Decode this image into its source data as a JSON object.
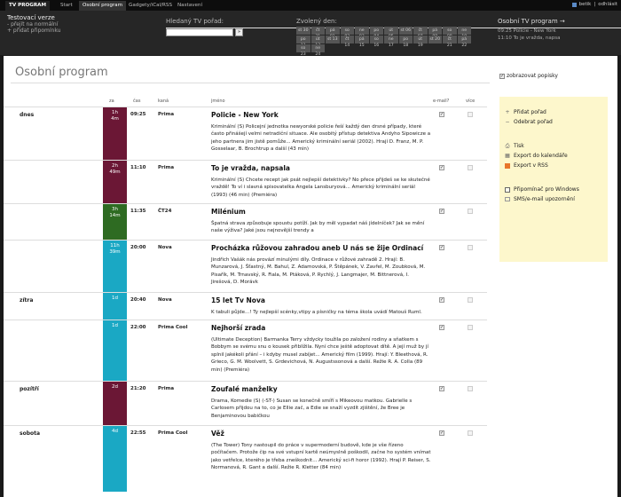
{
  "nav": {
    "tabs": [
      "TV PROGRAM",
      "Start",
      "Osobní program",
      "Gadgety/iCal/RSS",
      "Nastavení"
    ],
    "user": "betik",
    "logout": "odhlásit"
  },
  "header": {
    "title": "Testovací verze",
    "link1": "- přejít na normální",
    "link2": "+ přidat připomínku",
    "search_label": "Hledaný TV pořad:",
    "search_placeholder": "",
    "search_button": "»",
    "day_label": "Zvolený den:",
    "days": [
      "st 30",
      "čt 31",
      "pá 01",
      "so 02",
      "ne 03",
      "po 04",
      "út 05",
      "st 06",
      "čt 07",
      "pá 08",
      "so 09",
      "ne 10",
      "po 11",
      "út 12",
      "st 13",
      "čt 14",
      "pá 15",
      "so 16",
      "ne 17",
      "po 18",
      "út 19",
      "st 20",
      "čt 21",
      "pá 22",
      "so 23",
      "ne 24"
    ],
    "personal_label": "Osobní TV program →",
    "personal_items": [
      "09:25  Policie - New York",
      "11:10  To je vražda, napsa"
    ]
  },
  "page": {
    "title": "Osobní program",
    "columns": {
      "za": "za",
      "cas": "čas",
      "kana": "kaná",
      "jmeno": "jméno",
      "email": "e-mail?",
      "vice": "více"
    },
    "show_desc": "zobrazovat popisky"
  },
  "days_groups": [
    "dnes",
    "zítra",
    "pozítří",
    "sobota"
  ],
  "programs": [
    {
      "day": "dnes",
      "dur1": "1h",
      "dur2": "4m",
      "color": "#6b1735",
      "time": "09:25",
      "channel": "Prima",
      "title": "Policie - New York",
      "desc": "Kriminální (S) Policejní jednotka newyorské policie řeší každý den drsné případy, které často přinášejí velmi netradiční situace. Ale osobitý přístup detektiva Andyho Sipowicze a jeho partnera jim jistě pomůže... Americký kriminální seriál (2002). Hrají D. Franz, M. P. Gosselaar, B. Brochtrup a další (43 min)"
    },
    {
      "day": "",
      "dur1": "2h",
      "dur2": "49m",
      "color": "#6b1735",
      "time": "11:10",
      "channel": "Prima",
      "title": "To je vražda, napsala",
      "desc": "Kriminální (S) Chcete recept jak psát nejlepší detektivky? No přece přijdeš se ke skutečné vraždě! To ví i slavná spisovatelka Angela Lansburyová... Americký kriminální seriál (1993) (46 min) (Premiéra)"
    },
    {
      "day": "",
      "dur1": "3h",
      "dur2": "14m",
      "color": "#2e6b22",
      "time": "11:35",
      "channel": "ČT24",
      "title": "Milénium",
      "desc": "Špatná strava způsobuje spoustu potíží. Jak by měl vypadat náš jídelníček? Jak se mění naše výživa? Jaké jsou nejnovější trendy a"
    },
    {
      "day": "",
      "dur1": "11h",
      "dur2": "39m",
      "color": "#1aa8c4",
      "time": "20:00",
      "channel": "Nova",
      "title": "Procházka růžovou zahradou aneb U nás se žije Ordinací",
      "desc": "Jindřich Vašák nás provází minulými díly. Ordinace v růžové zahradě 2. Hrají: B. Munzarová, J. Šťastný, M. Bahul, Z. Adamovská, P. Štěpánek, V. Zavřel, M. Zoubková, M. Pisařík, M. Trnavský, R. Fiala, M. Ptáková, P. Rychlý, J. Langmajer, M. Bittnerová, I. Jirešová, D. Morávk"
    },
    {
      "day": "zítra",
      "dur1": "1d",
      "dur2": "",
      "color": "#1aa8c4",
      "time": "20:40",
      "channel": "Nova",
      "title": "15 let Tv Nova",
      "desc": "K tabuli půjde...! Ty nejlepší scénky,vtipy a písničky na téma škola uvádí Matouš Ruml."
    },
    {
      "day": "",
      "dur1": "1d",
      "dur2": "",
      "color": "#1aa8c4",
      "time": "22:00",
      "channel": "Prima Cool",
      "title": "Nejhorší zrada",
      "desc": "(Ultimate Deception) Barmanka Terry vždycky toužila po založení rodiny a sňatkem s Bobbym se svému snu o kousek přiblížila. Nyní chce ještě adoptovat dítě. A její muž by jí splnil jakékoli přání – i kdyby musel zabíjet... Americký film (1999). Hrají: Y. Bleethová, R. Grieco, G. M. Woolvett, S. Grdevichová, N. Augustssonová a další. Režie R. A. Colla (89 min) (Premiéra)"
    },
    {
      "day": "pozítří",
      "dur1": "2d",
      "dur2": "",
      "color": "#6b1735",
      "time": "21:20",
      "channel": "Prima",
      "title": "Zoufalé manželky",
      "desc": "Drama, Komedie (S) (-ST-) Susan se konečně smíří s Mikeovou matkou. Gabrielle s Carlosem přijdou na to, co je Ellie zač, a Edie se snaží vyzdít zjištění, že Bree je Benjaminovou babičkou"
    },
    {
      "day": "sobota",
      "dur1": "4d",
      "dur2": "",
      "color": "#1aa8c4",
      "time": "22:55",
      "channel": "Prima Cool",
      "title": "Věž",
      "desc": "(The Tower) Tony nastoupil do práce v supermoderní budově, kde je vše řízeno počítačem. Protože čip na své vstupní kartě neúmyslně poškodil, začne ho systém vnímat jako vetřelce, kterého je třeba zneškodnit... Americký sci-fi horor (1992). Hrají P. Reiser, S. Normanová, R. Gant a další. Režie R. Kletter (84 min)"
    }
  ],
  "sidebar": {
    "add": "Přidat pořad",
    "remove": "Odebrat pořad",
    "print": "Tisk",
    "export_cal": "Export do kalendáře",
    "export_rss": "Export v RSS",
    "win_reminder": "Připomínač pro Windows",
    "sms": "SMS/e-mail upozornění"
  }
}
